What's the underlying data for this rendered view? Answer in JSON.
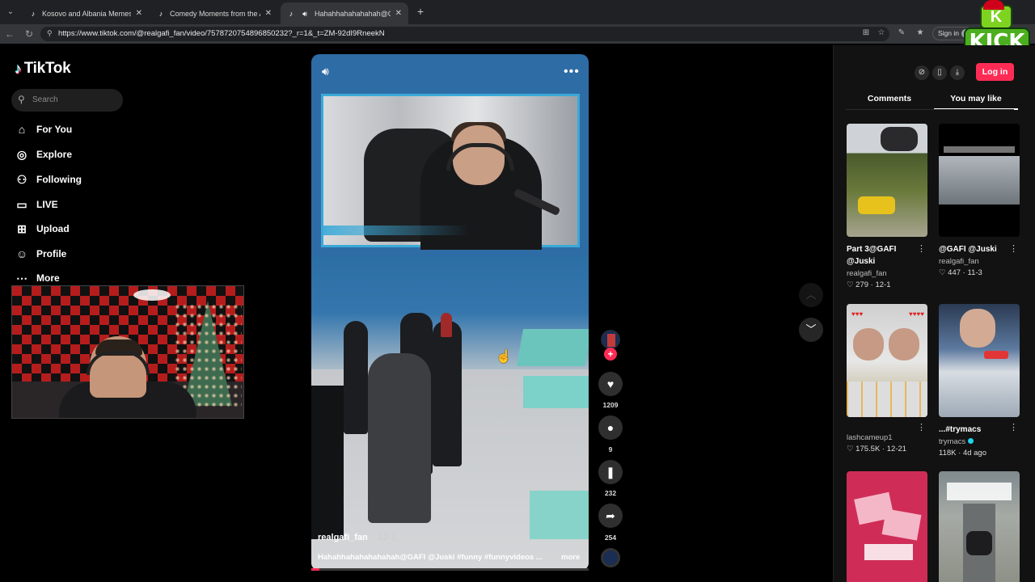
{
  "browser": {
    "tabs": [
      {
        "title": "Kosovo and Albania Memes Collec",
        "active": false
      },
      {
        "title": "Comedy Moments from the Alban",
        "active": false
      },
      {
        "title": "Hahahhahahahahah@GA",
        "active": true
      }
    ],
    "url": "https://www.tiktok.com/@realgafi_fan/video/7578720754896850232?_r=1&_t=ZM-92dI9RneekN",
    "signin_label": "Sign in"
  },
  "overlay": {
    "kick_top": "K",
    "kick_bottom": "KICK"
  },
  "sidebar": {
    "brand": "TikTok",
    "search_placeholder": "Search",
    "items": [
      {
        "label": "For You",
        "icon": "home-icon"
      },
      {
        "label": "Explore",
        "icon": "compass-icon"
      },
      {
        "label": "Following",
        "icon": "following-icon"
      },
      {
        "label": "LIVE",
        "icon": "live-icon"
      },
      {
        "label": "Upload",
        "icon": "upload-icon"
      },
      {
        "label": "Profile",
        "icon": "profile-icon"
      },
      {
        "label": "More",
        "icon": "more-icon"
      }
    ]
  },
  "video": {
    "author": "realgafi_fan",
    "date": "12-1",
    "caption": "Hahahhahahahahahah@GAFI @Juski #funny #funnyvideos ...",
    "more_label": "more",
    "progress": 0.03,
    "likes": "1209",
    "comments": "9",
    "saves": "232",
    "shares": "254"
  },
  "right_panel": {
    "login_label": "Log in",
    "tabs": [
      {
        "label": "Comments",
        "active": false
      },
      {
        "label": "You may like",
        "active": true
      }
    ],
    "cards": [
      {
        "title_lines": [
          "Part 3@GAFI",
          "@Juski"
        ],
        "user": "realgafi_fan",
        "likes": "279",
        "date": "12-1"
      },
      {
        "title_lines": [
          "@GAFI @Juski"
        ],
        "user": "realgafi_fan",
        "likes": "447",
        "date": "11-3"
      },
      {
        "title_lines": [],
        "user": "lashcameup1",
        "likes": "175.5K",
        "date": "12-21"
      },
      {
        "title_lines": [
          "...#trymacs"
        ],
        "user": "trymacs",
        "likes": "118K",
        "date": "4d ago"
      },
      {
        "title_lines": [],
        "user": "",
        "likes": "",
        "date": ""
      },
      {
        "title_lines": [],
        "user": "",
        "likes": "",
        "date": ""
      }
    ]
  },
  "colors": {
    "accent": "#fe2c55",
    "background": "#000000",
    "panel": "#121212"
  }
}
